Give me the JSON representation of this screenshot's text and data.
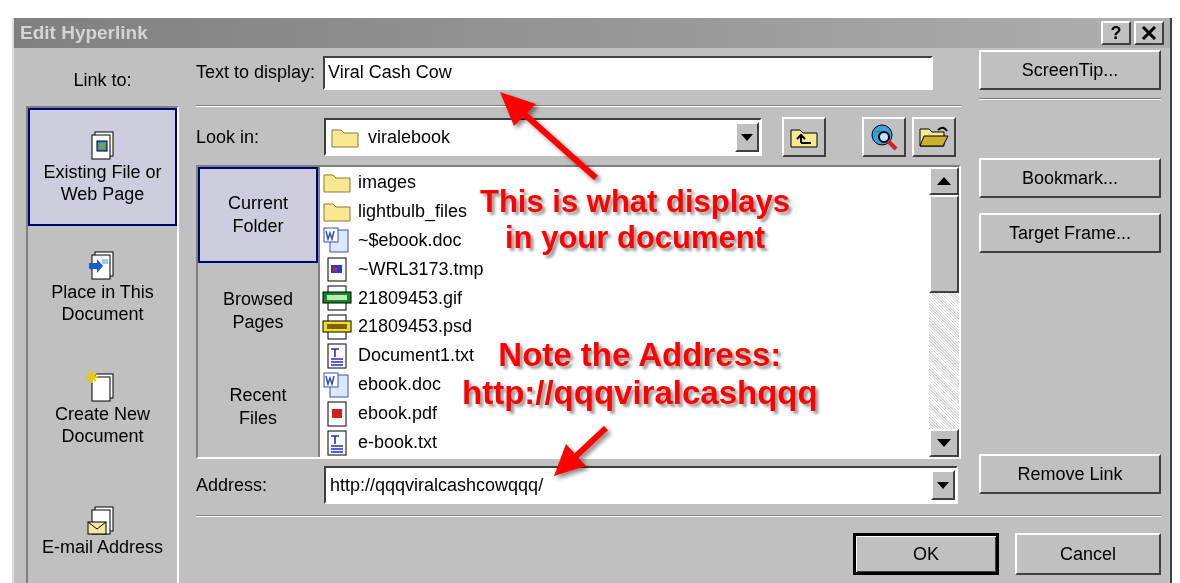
{
  "window": {
    "title": "Edit Hyperlink",
    "help_button": "?"
  },
  "link_to": {
    "label": "Link to:",
    "items": [
      {
        "kind": "existing",
        "label": "Existing File or Web Page",
        "selected": true
      },
      {
        "kind": "place",
        "label": "Place in This Document",
        "selected": false
      },
      {
        "kind": "new",
        "label": "Create New Document",
        "selected": false
      },
      {
        "kind": "email",
        "label": "E-mail Address",
        "selected": false
      }
    ]
  },
  "text_to_display": {
    "label": "Text to display:",
    "value": "Viral Cash Cow"
  },
  "screentip_button": "ScreenTip...",
  "look_in": {
    "label": "Look in:",
    "value": "viralebook"
  },
  "browse": {
    "items": [
      {
        "label": "Current Folder",
        "selected": true
      },
      {
        "label": "Browsed Pages",
        "selected": false
      },
      {
        "label": "Recent Files",
        "selected": false
      }
    ]
  },
  "files": [
    {
      "kind": "folder",
      "name": "images"
    },
    {
      "kind": "folder",
      "name": "lightbulb_files"
    },
    {
      "kind": "doc",
      "name": "~$ebook.doc"
    },
    {
      "kind": "tmp",
      "name": "~WRL3173.tmp"
    },
    {
      "kind": "gif",
      "name": "21809453.gif"
    },
    {
      "kind": "psd",
      "name": "21809453.psd"
    },
    {
      "kind": "txt",
      "name": "Document1.txt"
    },
    {
      "kind": "doc",
      "name": "ebook.doc"
    },
    {
      "kind": "pdf",
      "name": "ebook.pdf"
    },
    {
      "kind": "txt",
      "name": "e-book.txt"
    }
  ],
  "side_buttons": [
    "Bookmark...",
    "Target Frame..."
  ],
  "address": {
    "label": "Address:",
    "value": "http://qqqviralcashcowqqq/"
  },
  "remove_link_button": "Remove Link",
  "buttons": [
    {
      "label": "OK",
      "default": true
    },
    {
      "label": "Cancel",
      "default": false
    }
  ],
  "annotations": [
    {
      "lines": [
        "This is what displays",
        "in your document"
      ]
    },
    {
      "lines": [
        "Note the Address:",
        "http://qqqviralcashqqq"
      ]
    }
  ]
}
